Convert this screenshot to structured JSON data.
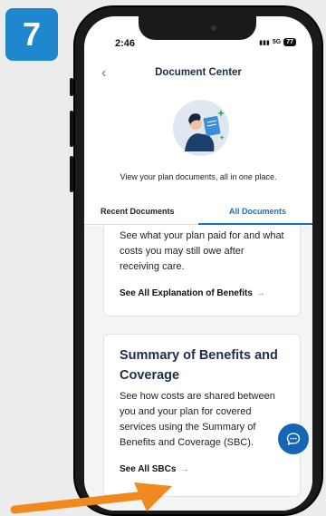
{
  "step": {
    "number": "7"
  },
  "status_bar": {
    "time": "2:46",
    "network": "5G",
    "battery": "77"
  },
  "header": {
    "title": "Document Center",
    "back_icon": "chevron-left-icon"
  },
  "intro": {
    "text": "View your plan documents, all in one place."
  },
  "tabs": [
    {
      "label": "Recent Documents",
      "active": false
    },
    {
      "label": "All Documents",
      "active": true
    }
  ],
  "cards": {
    "eob": {
      "description": "See what your plan paid for and what costs you may still owe after receiving care.",
      "link": "See All Explanation of Benefits"
    },
    "sbc": {
      "title": "Summary of Benefits and Coverage",
      "description": "See how costs are shared between you and your plan for covered services using the Summary of Benefits and Coverage (SBC).",
      "link": "See All SBCs"
    }
  },
  "colors": {
    "accent": "#1f6fbf",
    "badge": "#1f87cd",
    "arrow": "#f08a1c",
    "title": "#1c2f4a"
  }
}
